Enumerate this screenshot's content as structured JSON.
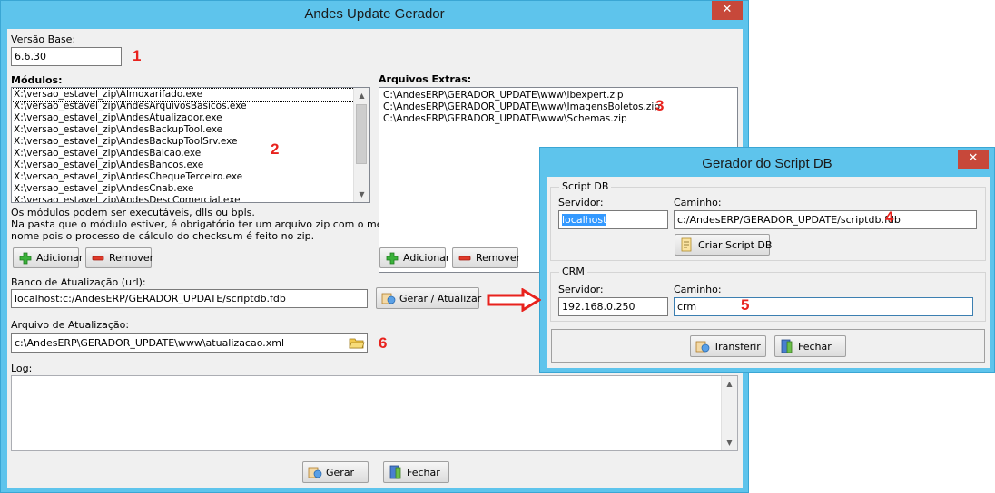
{
  "main_window": {
    "title": "Andes Update Gerador",
    "close_label": "✕",
    "versao_base_label": "Versão Base:",
    "versao_base_value": "6.6.30",
    "modulos_label": "Módulos:",
    "modulos": [
      "X:\\versao_estavel_zip\\Almoxarifado.exe",
      "X:\\versao_estavel_zip\\AndesArquivosBasicos.exe",
      "X:\\versao_estavel_zip\\AndesAtualizador.exe",
      "X:\\versao_estavel_zip\\AndesBackupTool.exe",
      "X:\\versao_estavel_zip\\AndesBackupToolSrv.exe",
      "X:\\versao_estavel_zip\\AndesBalcao.exe",
      "X:\\versao_estavel_zip\\AndesBancos.exe",
      "X:\\versao_estavel_zip\\AndesChequeTerceiro.exe",
      "X:\\versao_estavel_zip\\AndesCnab.exe",
      "X:\\versao_estavel_zip\\AndesDescComercial.exe"
    ],
    "modulos_note_1": "Os módulos podem ser executáveis, dlls ou bpls.",
    "modulos_note_2": "Na pasta que o módulo estiver, é obrigatório  ter um arquivo zip com o mesmo",
    "modulos_note_3": "nome pois o  processo de cálculo do checksum é feito no zip.",
    "adicionar_label": "Adicionar",
    "remover_label": "Remover",
    "arquivos_extras_label": "Arquivos Extras:",
    "arquivos_extras": [
      "C:\\AndesERP\\GERADOR_UPDATE\\www\\ibexpert.zip",
      "C:\\AndesERP\\GERADOR_UPDATE\\www\\ImagensBoletos.zip",
      "C:\\AndesERP\\GERADOR_UPDATE\\www\\Schemas.zip"
    ],
    "banco_label": "Banco de Atualização (url):",
    "banco_value": "localhost:c:/AndesERP/GERADOR_UPDATE/scriptdb.fdb",
    "gerar_atualizar_label": "Gerar / Atualizar",
    "arquivo_label": "Arquivo de Atualização:",
    "arquivo_value": "c:\\AndesERP\\GERADOR_UPDATE\\www\\atualizacao.xml",
    "log_label": "Log:",
    "gerar_label": "Gerar",
    "fechar_label": "Fechar"
  },
  "dialog": {
    "title": "Gerador do Script DB",
    "close_label": "✕",
    "script_db_group": "Script DB",
    "servidor_label": "Servidor:",
    "servidor_value": "localhost",
    "caminho_label": "Caminho:",
    "caminho_value": "c:/AndesERP/GERADOR_UPDATE/scriptdb.fdb",
    "criar_script_label": "Criar Script DB",
    "crm_group": "CRM",
    "crm_servidor_label": "Servidor:",
    "crm_servidor_value": "192.168.0.250",
    "crm_caminho_label": "Caminho:",
    "crm_caminho_value": "crm",
    "transferir_label": "Transferir",
    "fechar_label": "Fechar"
  },
  "callouts": [
    "1",
    "2",
    "3",
    "4",
    "5",
    "6"
  ],
  "colors": {
    "titlebar": "#5ec4ec",
    "close": "#c7483a",
    "callout": "#e8221d"
  }
}
